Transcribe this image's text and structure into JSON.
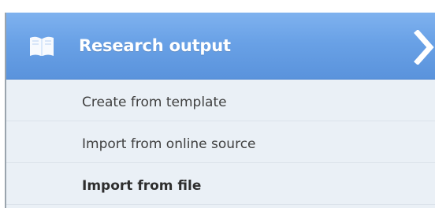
{
  "section": {
    "title": "Research output",
    "icon": "book-icon",
    "expand_icon": "chevron-right-icon",
    "header_color": "#6aa2e8"
  },
  "menu": {
    "items": [
      {
        "label": "Create from template",
        "active": false
      },
      {
        "label": "Import from online source",
        "active": false
      },
      {
        "label": "Import from file",
        "active": true
      }
    ]
  }
}
